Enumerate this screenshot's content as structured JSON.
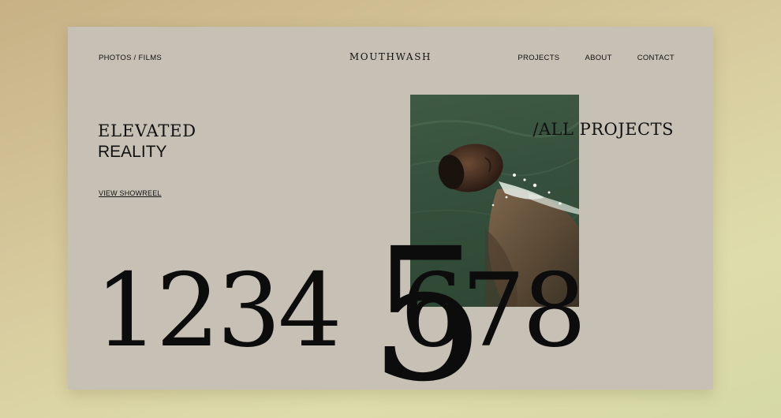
{
  "header": {
    "left_link": "PHOTOS / FILMS",
    "logo": "MOUTHWASH",
    "nav": [
      "PROJECTS",
      "ABOUT",
      "CONTACT"
    ]
  },
  "hero": {
    "line1": "ELEVATED",
    "line2": "REALITY",
    "showreel": "VIEW SHOWREEL"
  },
  "projects_link": "/ALL PROJECTS",
  "project_numbers": [
    "1",
    "2",
    "3",
    "4",
    "5",
    "6",
    "7",
    "8"
  ],
  "active_project": "5",
  "colors": {
    "page_bg": "#c6c1b4",
    "text": "#111111",
    "photo_water": "#35503c"
  }
}
